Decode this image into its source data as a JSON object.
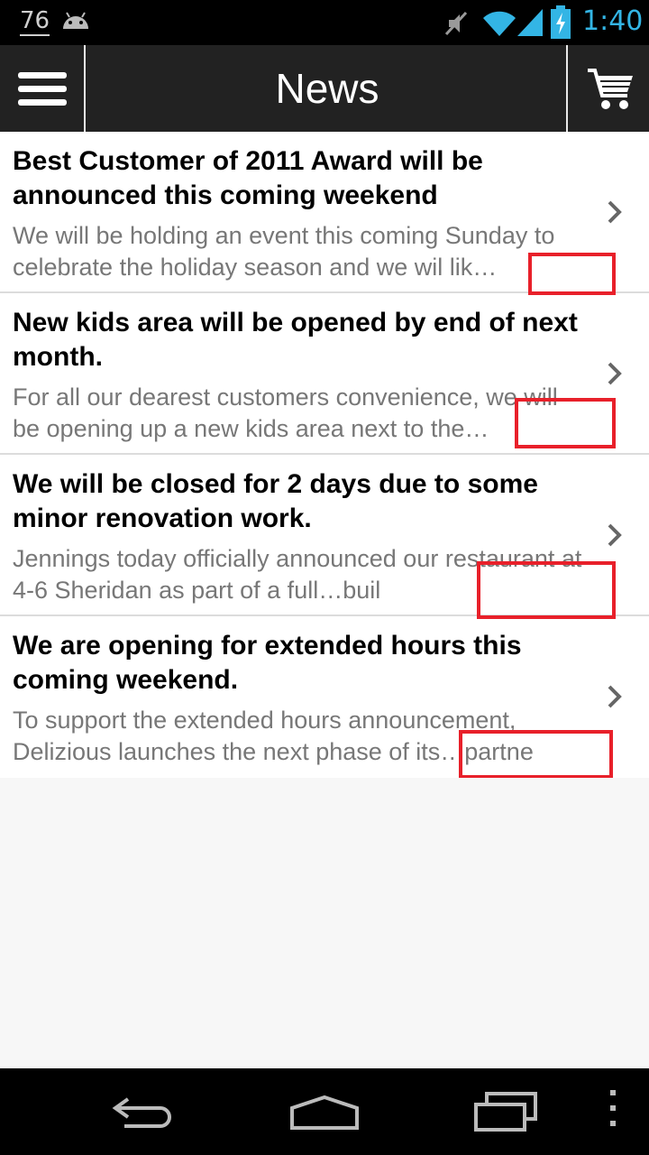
{
  "status_bar": {
    "notification_count": "76",
    "time": "1:40",
    "icons": [
      "android-icon",
      "mute-icon",
      "wifi-icon",
      "signal-icon",
      "battery-icon"
    ]
  },
  "action_bar": {
    "title": "News",
    "menu_icon": "hamburger-menu-icon",
    "cart_icon": "shopping-cart-icon"
  },
  "news": [
    {
      "title": "Best Customer of 2011 Award will be announced this coming weekend",
      "description": "We will be holding an event this coming Sunday to celebrate the holiday season and we wil lik…"
    },
    {
      "title": "New kids area will be opened by end of next month.",
      "description": "For all our dearest customers convenience, we will be opening up a new kids area next to the…"
    },
    {
      "title": "We will be closed for 2 days due to some minor renovation work.",
      "description": "Jennings today officially announced our restaurant at 4-6 Sheridan as part of a full…buil"
    },
    {
      "title": "We are opening for extended hours this coming weekend.",
      "description": "To support the extended hours announcement, Delizious launches the next phase of its…partne"
    }
  ],
  "nav_bar": {
    "icons": [
      "back-icon",
      "home-icon",
      "recent-apps-icon",
      "overflow-menu-icon"
    ]
  },
  "colors": {
    "action_bar": "#222222",
    "time": "#33b5e5",
    "highlight": "#e8202a"
  }
}
